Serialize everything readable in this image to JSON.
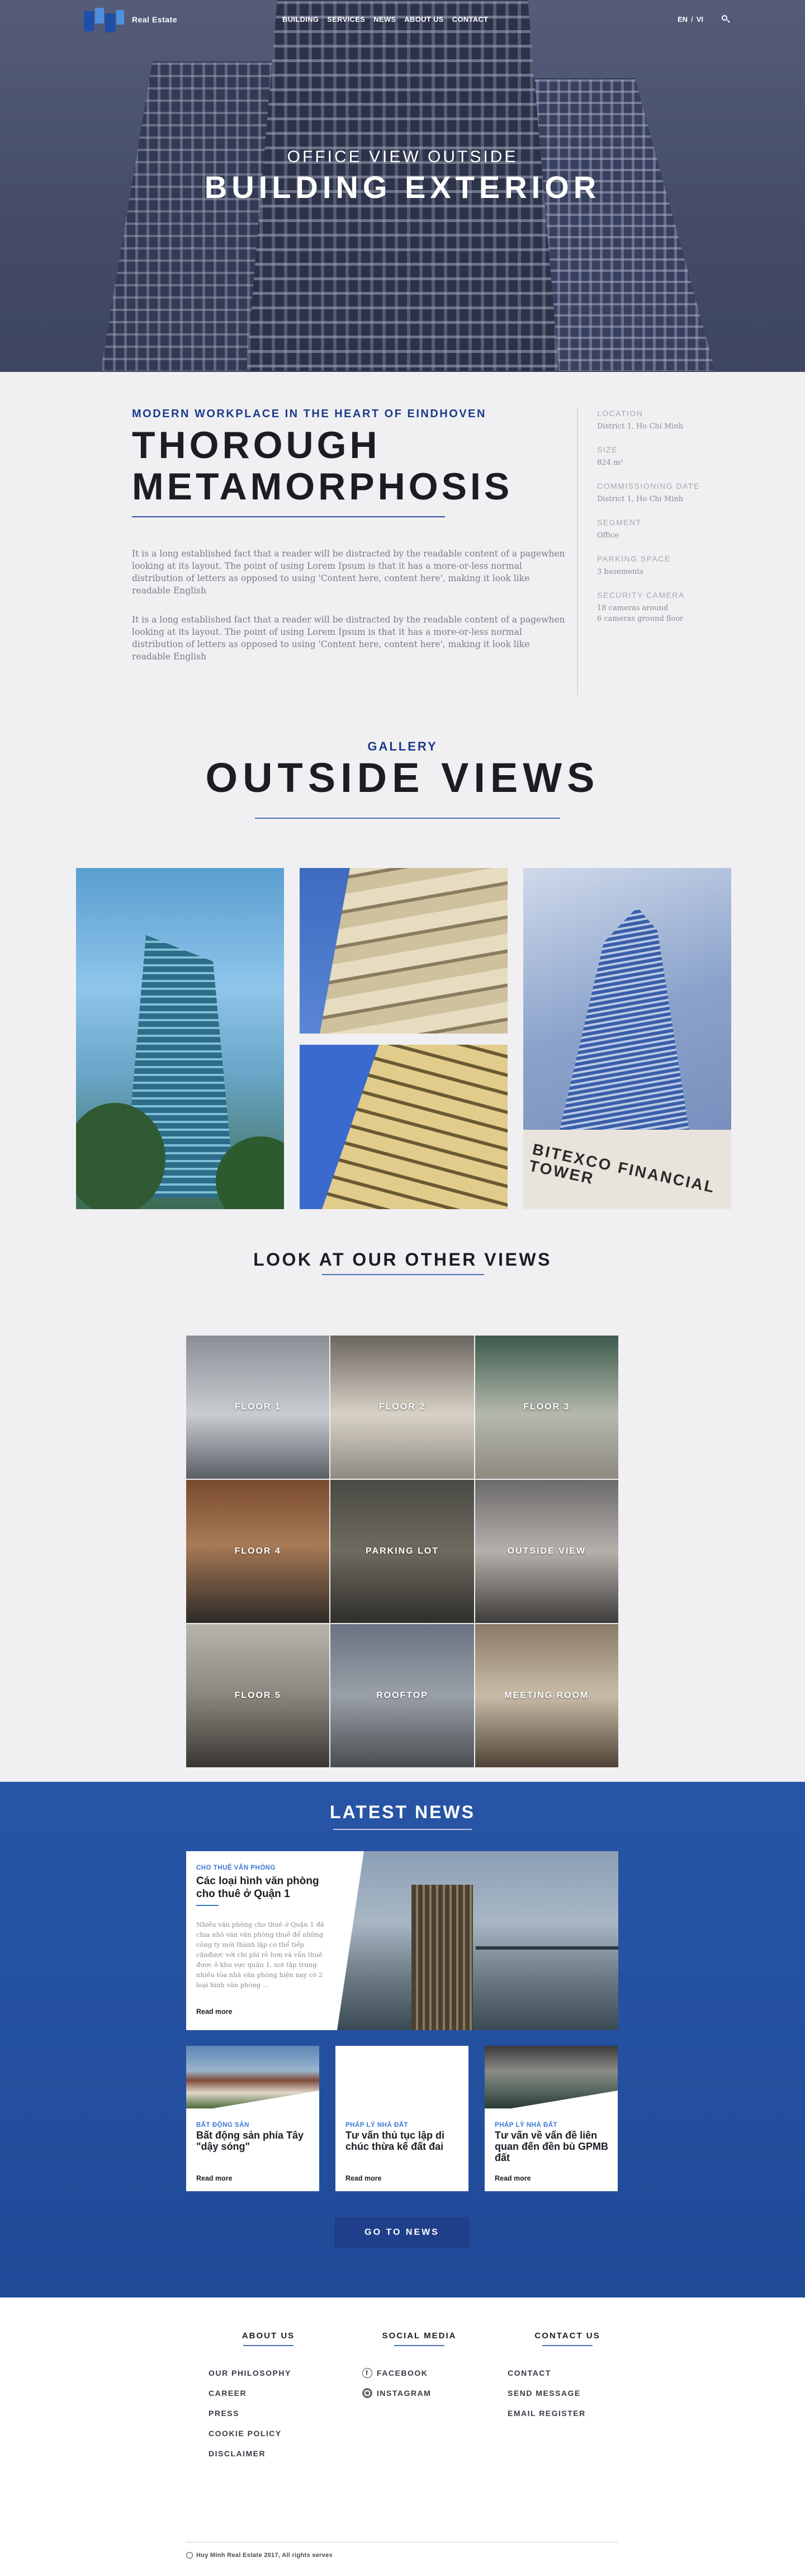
{
  "nav": {
    "brand": "Real Estate",
    "menu": [
      "BUILDING",
      "SERVICES",
      "NEWS",
      "ABOUT US",
      "CONTACT"
    ],
    "lang": {
      "en": "EN",
      "sep": "/",
      "vi": "VI"
    }
  },
  "hero": {
    "subtitle": "OFFICE VIEW OUTSIDE",
    "title": "BUILDING EXTERIOR"
  },
  "intro": {
    "kicker": "MODERN WORKPLACE IN THE HEART OF EINDHOVEN",
    "title_line1": "THOROUGH",
    "title_line2": "METAMORPHOSIS",
    "para1": "It is a long established fact that a reader will be distracted by the readable content of a pagewhen looking at its layout. The point of using Lorem Ipsum is that it has a more-or-less normal distribution of letters as opposed to using 'Content here, content here', making it look like readable English",
    "para2": "It is a long established fact that a reader will be distracted by the readable content of a pagewhen looking at its layout. The point of using Lorem Ipsum is that it has a more-or-less normal distribution of letters as opposed to using 'Content here, content here', making it look like readable English",
    "facts": [
      {
        "k": "LOCATION",
        "v": "District 1, Ho Chi Minh"
      },
      {
        "k": "SIZE",
        "v": "824 m²"
      },
      {
        "k": "COMMISSIONING DATE",
        "v": "District 1, Ho Chi Minh"
      },
      {
        "k": "SEGMENT",
        "v": "Office"
      },
      {
        "k": "PARKING SPACE",
        "v": "3 basements"
      },
      {
        "k": "SECURITY CAMERA",
        "v": "18 cameras around\n6 cameras ground floor"
      }
    ]
  },
  "gallery": {
    "kicker": "GALLERY",
    "title": "OUTSIDE VIEWS",
    "sign_text": "BITEXCO FINANCIAL TOWER",
    "other_title": "LOOK AT OUR OTHER VIEWS",
    "tiles": [
      "FLOOR 1",
      "FLOOR 2",
      "FLOOR 3",
      "FLOOR 4",
      "PARKING LOT",
      "OUTSIDE VIEW",
      "FLOOR 5",
      "ROOFTOP",
      "MEETING ROOM"
    ]
  },
  "news": {
    "title": "LATEST NEWS",
    "featured": {
      "category": "CHO THUÊ VĂN PHÒNG",
      "headline": "Các loại hình văn phòng cho thuê ở Quận 1",
      "desc": "Nhiều văn phòng cho thuê ở Quận 1 đã chia nhỏ văn văn phòng thuê để những công ty mới thành lập có thể tiếp cậnđược với chi phí rẻ hơn và vẫn thuê được ở khu vực quận 1, nơi tập trung nhiều tòa nhà văn phòng hiện nay có 2 loại hình văn phòng ...",
      "more": "Read more"
    },
    "cards": [
      {
        "category": "BẤT ĐỘNG SẢN",
        "headline": "Bất động sản phía Tây \"dậy sóng\"",
        "more": "Read more"
      },
      {
        "category": "PHÁP LÝ NHÀ ĐẤT",
        "headline": "Tư vấn thủ tục lập di chúc thừa kế đất đai",
        "more": "Read more"
      },
      {
        "category": "PHÁP LÝ NHÀ ĐẤT",
        "headline": "Tư vấn về vấn đề liên quan đến đền bù GPMB đất",
        "more": "Read more"
      }
    ],
    "button": "GO TO NEWS"
  },
  "footer": {
    "about": {
      "title": "ABOUT US",
      "items": [
        "OUR PHILOSOPHY",
        "CAREER",
        "PRESS",
        "COOKIE POLICY",
        "DISCLAIMER"
      ]
    },
    "social": {
      "title": "SOCIAL MEDIA",
      "items": [
        "FACEBOOK",
        "INSTAGRAM"
      ]
    },
    "contact": {
      "title": "CONTACT US",
      "items": [
        "CONTACT",
        "SEND MESSAGE",
        "EMAIL REGISTER"
      ]
    },
    "copyright": "Huy Minh Real Estate 2017, All rights serves"
  }
}
